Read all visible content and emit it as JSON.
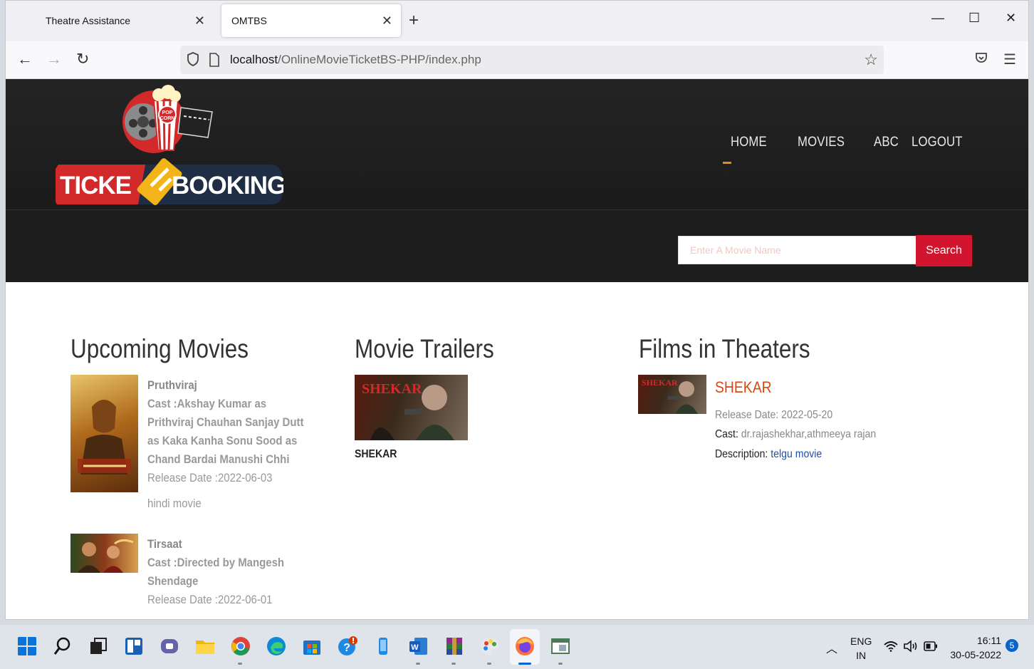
{
  "browser": {
    "tabs": [
      {
        "label": "Theatre Assistance"
      },
      {
        "label": "OMTBS"
      }
    ],
    "address": {
      "host": "localhost",
      "path": "/OnlineMovieTicketBS-PHP/index.php"
    }
  },
  "site": {
    "logo": {
      "text_left": "TICKE",
      "text_right": "BOOKING",
      "badge_lines": [
        "POP",
        "CORN"
      ]
    },
    "nav": [
      "HOME",
      "MOVIES",
      "ABC",
      "LOGOUT"
    ],
    "active_nav": "HOME",
    "accent_color": "#d2152e",
    "search": {
      "placeholder": "Enter A Movie Name",
      "button": "Search"
    },
    "upcoming": {
      "title": "Upcoming Movies",
      "movies": [
        {
          "name": "Pruthviraj",
          "cast": "Cast :Akshay Kumar as Prithviraj Chauhan Sanjay Dutt as Kaka Kanha Sonu Sood as Chand Bardai Manushi Chhi",
          "release": "Release Date :2022-06-03",
          "description": "hindi movie"
        },
        {
          "name": "Tirsaat",
          "cast": "Cast :Directed by Mangesh Shendage",
          "release": "Release Date :2022-06-01"
        }
      ]
    },
    "trailers": {
      "title": "Movie Trailers",
      "items": [
        {
          "name": "SHEKAR"
        }
      ]
    },
    "theaters": {
      "title": "Films in Theaters",
      "films": [
        {
          "name": "SHEKAR",
          "release_label": "Release Date:",
          "release": "2022-05-20",
          "cast_label": "Cast:",
          "cast": "dr.rajashekhar,athmeeya rajan",
          "description_label": "Description:",
          "description": "telgu movie"
        }
      ]
    }
  },
  "taskbar": {
    "language": [
      "ENG",
      "IN"
    ],
    "time": "16:11",
    "date": "30-05-2022",
    "notifications": "5"
  }
}
